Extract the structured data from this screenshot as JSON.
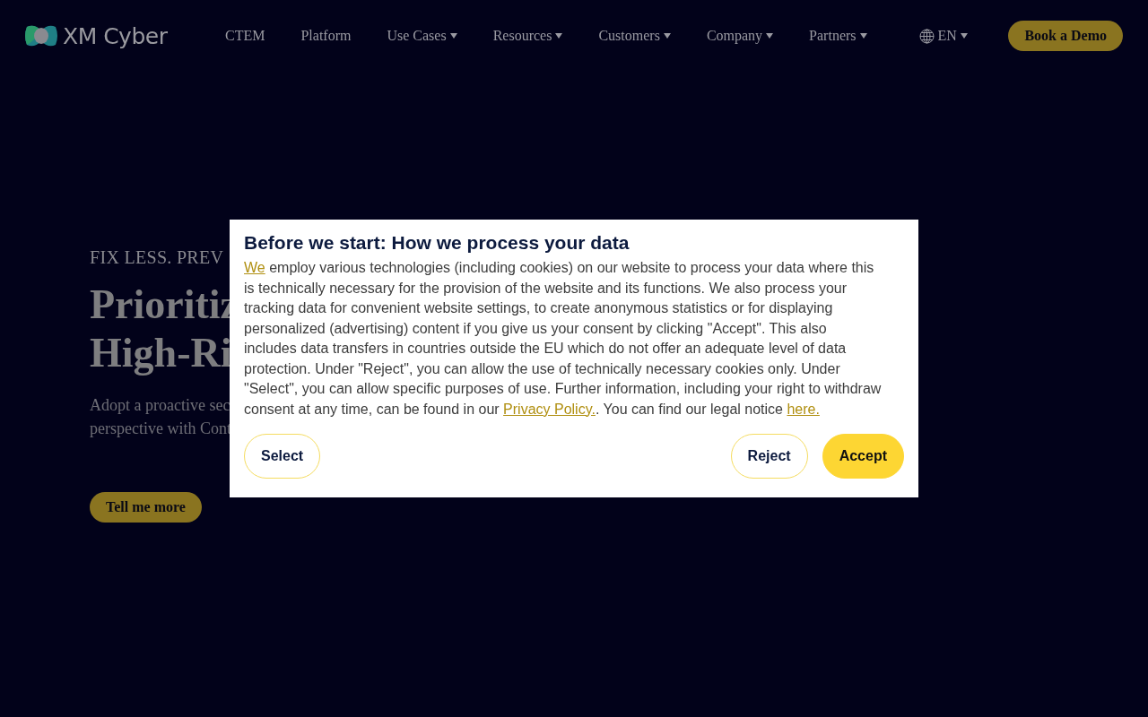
{
  "header": {
    "logo": "XM Cyber",
    "nav": [
      {
        "label": "CTEM",
        "dropdown": false
      },
      {
        "label": "Platform",
        "dropdown": false
      },
      {
        "label": "Use Cases",
        "dropdown": true
      },
      {
        "label": "Resources",
        "dropdown": true
      },
      {
        "label": "Customers",
        "dropdown": true
      },
      {
        "label": "Company",
        "dropdown": true
      },
      {
        "label": "Partners",
        "dropdown": true
      }
    ],
    "language": "EN",
    "cta": "Book a Demo"
  },
  "hero": {
    "eyebrow": "FIX LESS. PREV",
    "headline": [
      "Prioritiz",
      "High-Ri"
    ],
    "subtext": [
      "Adopt a proactive sec",
      "perspective with Cont"
    ],
    "button": "Tell me more"
  },
  "consent": {
    "title": "Before we start: How we process your data",
    "body": [
      {
        "kind": "link",
        "text": "We"
      },
      {
        "kind": "text",
        "text": " employ various technologies (including cookies) on our website to process your data where this is technically necessary for the provision of the website and its functions. We also process your tracking data for convenient website settings, to create anonymous statistics or for displaying personalized (advertising) content if you give us your consent by clicking \"Accept\". This also includes data transfers in countries outside the EU which do not offer an adequate level of data protection. Under \"Reject\", you can allow the use of technically necessary cookies only. Under \"Select\", you can allow specific purposes of use. Further information, including your right to withdraw consent at any time, can be found in our "
      },
      {
        "kind": "link",
        "text": "Privacy Policy."
      },
      {
        "kind": "text",
        "text": ". You can find our legal notice "
      },
      {
        "kind": "link",
        "text": "here."
      }
    ],
    "buttons": [
      {
        "label": "Select",
        "kind": "outline"
      },
      {
        "label": "Reject",
        "kind": "outline"
      },
      {
        "label": "Accept",
        "kind": "primary"
      }
    ]
  }
}
